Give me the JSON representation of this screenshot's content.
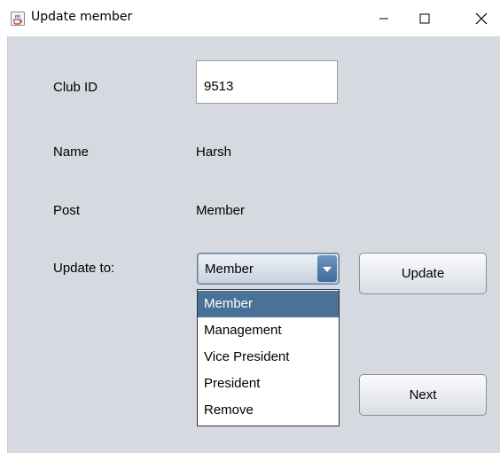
{
  "window": {
    "title": "Update member",
    "icon": "java-coffee-icon",
    "controls": [
      "minimize-icon",
      "maximize-icon",
      "close-icon"
    ]
  },
  "form": {
    "club_id_label": "Club ID",
    "club_id_value": "9513",
    "name_label": "Name",
    "name_value": "Harsh",
    "post_label": "Post",
    "post_value": "Member",
    "update_to_label": "Update to:",
    "selected_option": "Member",
    "options": [
      "Member",
      "Management",
      "Vice President",
      "President",
      "Remove"
    ],
    "update_button": "Update",
    "next_button": "Next"
  }
}
